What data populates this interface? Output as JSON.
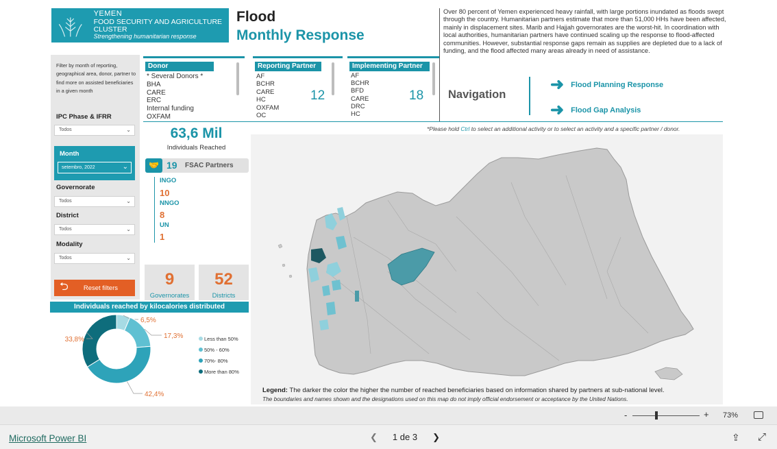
{
  "header": {
    "logo_line1": "YEMEN",
    "logo_line2": "FOOD SECURITY AND AGRICULTURE CLUSTER",
    "logo_line3": "Strengthening humanitarian response",
    "title_line1": "Flood",
    "title_line2": "Monthly Response",
    "description": "Over 80 percent of Yemen experienced heavy rainfall, with large portions inundated as floods swept through the country. Humanitarian partners estimate that more than 51,000 HHs have been affected, mainly in displacement sites. Marib and Hajjah governorates are the worst-hit. In coordination with local authorities, humanitarian partners have continued scaling up the response to flood-affected communities. However, substantial response gaps remain as supplies are depleted due to a lack of funding, and the flood affected many areas already in need of assistance."
  },
  "filters": {
    "hint": "Filter by month of reporting, geographical area, donor, partner to find more on assisted beneficiaries in a given month",
    "ipc_label": "IPC Phase & IFRR",
    "ipc_value": "Todos",
    "month_label": "Month",
    "month_value": "setembro, 2022",
    "governorate_label": "Governorate",
    "governorate_value": "Todos",
    "district_label": "District",
    "district_value": "Todos",
    "modality_label": "Modality",
    "modality_value": "Todos",
    "reset_label": "Reset filters"
  },
  "slicers": {
    "donor": {
      "header": "Donor",
      "items": [
        "* Several Donors *",
        "BHA",
        "CARE",
        "ERC",
        "Internal funding",
        "OXFAM"
      ]
    },
    "reporting": {
      "header": "Reporting Partner",
      "items": [
        "AF",
        "BCHR",
        "CARE",
        "HC",
        "OXFAM",
        "OC"
      ],
      "count": "12"
    },
    "implementing": {
      "header": "Implementing Partner",
      "items": [
        "AF",
        "BCHR",
        "BFD",
        "CARE",
        "DRC",
        "HC"
      ],
      "count": "18"
    }
  },
  "navigation": {
    "title": "Navigation",
    "link1": "Flood Planning Response",
    "link2": "Flood Gap Analysis",
    "note_pre": "*Please hold ",
    "note_key": "Ctrl",
    "note_post": " to select an additional activity or to select an activity and a specific partner / donor."
  },
  "kpis": {
    "reached_value": "63,6 Mil",
    "reached_label": "Individuals Reached",
    "partners_count": "19",
    "partners_label": "FSAC Partners",
    "types": [
      {
        "label": "INGO",
        "value": "10"
      },
      {
        "label": "NNGO",
        "value": "8"
      },
      {
        "label": "UN",
        "value": "1"
      }
    ],
    "governorates_value": "9",
    "governorates_label": "Governorates",
    "districts_value": "52",
    "districts_label": "Districts"
  },
  "chart_data": {
    "type": "pie",
    "title": "Individuals reached by kilocalories distributed",
    "categories": [
      "Less than 50%",
      "50% - 60%",
      "70%- 80%",
      "More than 80%"
    ],
    "values": [
      6.5,
      17.3,
      42.4,
      33.8
    ],
    "value_labels": [
      "6,5%",
      "17,3%",
      "42,4%",
      "33,8%"
    ],
    "colors": [
      "#a6dbe4",
      "#5fc0d2",
      "#2ea3b9",
      "#0e6d7c"
    ],
    "legend_position": "right"
  },
  "map": {
    "legend_title": "Legend:",
    "legend_text": " The darker the color the higher the number of reached beneficiaries based on information shared by partners at sub-national level.",
    "disclaimer": "The boundaries and names shown and the designations used on this map do not imply official endorsement or acceptance by the United Nations."
  },
  "zoom": {
    "minus": "-",
    "plus": "+",
    "percent": "73%"
  },
  "footer": {
    "link": "Microsoft Power BI",
    "page": "1 de 3"
  },
  "colors": {
    "accent": "#1b94a8",
    "orange": "#e07033",
    "reset": "#e35f25"
  }
}
